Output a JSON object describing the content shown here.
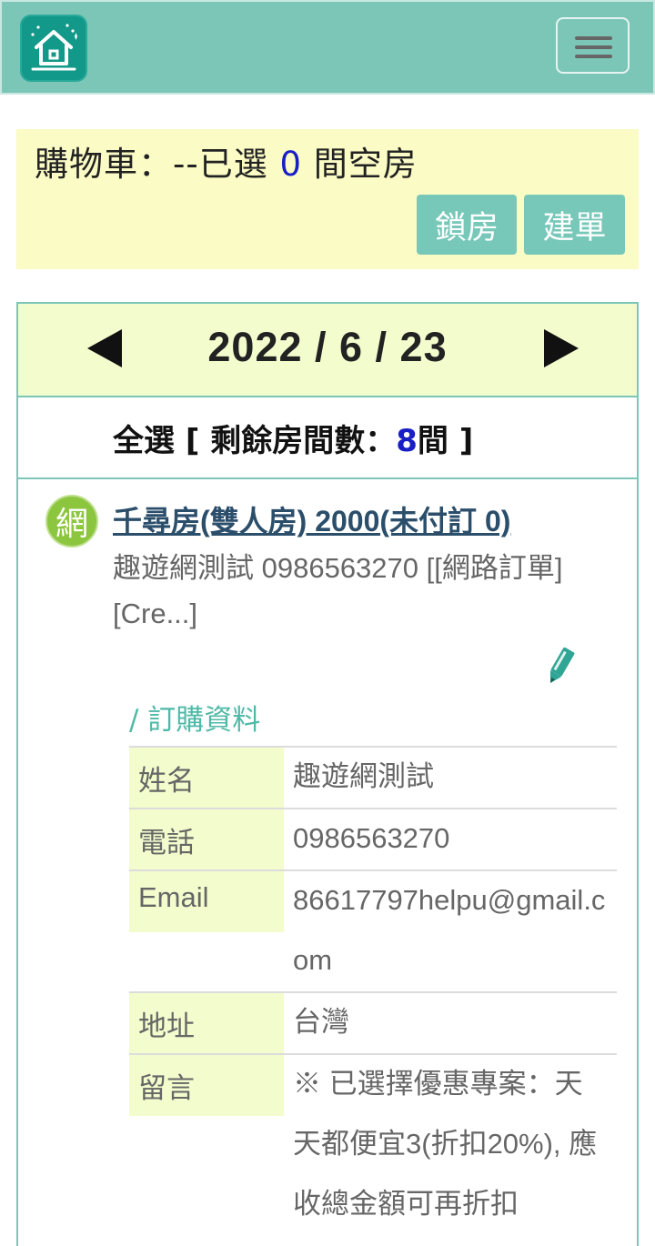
{
  "header": {
    "logo_icon": "house-icon",
    "menu_icon": "hamburger-menu-icon"
  },
  "cart": {
    "label": "購物車：--已選 ",
    "count": "0",
    "suffix": " 間空房",
    "lock_button": "鎖房",
    "order_button": "建單"
  },
  "calendar": {
    "date": "2022 / 6 / 23",
    "prev_icon": "triangle-left-icon",
    "next_icon": "triangle-right-icon"
  },
  "select_all": {
    "prefix": "全選 [ 剩餘房間數：",
    "count": "8",
    "suffix": "間 ]"
  },
  "room": {
    "badge": "網",
    "title": "千尋房(雙人房) 2000(未付訂 0)",
    "subtitle": "趣遊網測試 0986563270 [[網路訂單][Cre...]",
    "edit_icon": "pencil-icon"
  },
  "order": {
    "heading": "/ 訂購資料",
    "rows": [
      {
        "key": "姓名",
        "value": "趣遊網測試"
      },
      {
        "key": "電話",
        "value": "0986563270"
      },
      {
        "key": "Email",
        "value": "86617797helpu@gmail.com"
      },
      {
        "key": "地址",
        "value": "台灣"
      },
      {
        "key": "留言",
        "value": "※ 已選擇優惠專案：天天都便宜3(折扣20%), 應收總金額可再折扣"
      }
    ]
  },
  "colors": {
    "header_bg": "#7cc6b8",
    "cart_bg": "#fbfbc5",
    "button_bg": "#77c8b9",
    "calendar_head_bg": "#f3fccd",
    "count_blue": "#1a1fc5",
    "badge_green": "#8cc63f",
    "accent_teal": "#4fb9a7"
  }
}
